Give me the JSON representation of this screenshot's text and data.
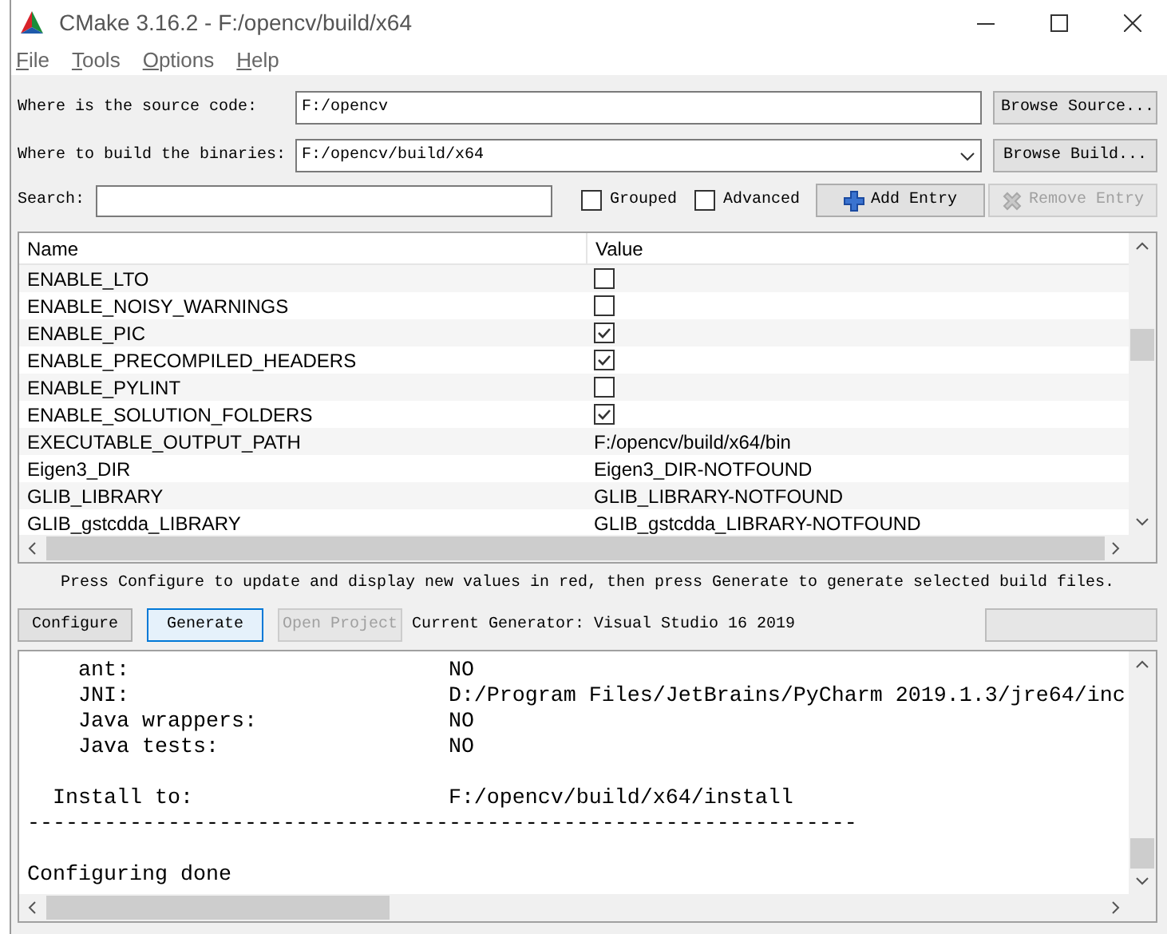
{
  "window": {
    "title": "CMake 3.16.2 - F:/opencv/build/x64"
  },
  "menu": [
    "File",
    "Tools",
    "Options",
    "Help"
  ],
  "source": {
    "label": "Where is the source code:",
    "value": "F:/opencv",
    "button": "Browse Source..."
  },
  "build": {
    "label": "Where to build the binaries:",
    "value": "F:/opencv/build/x64",
    "button": "Browse Build..."
  },
  "search": {
    "label": "Search:"
  },
  "options": [
    {
      "label": "Grouped",
      "checked": false
    },
    {
      "label": "Advanced",
      "checked": false
    }
  ],
  "entry_buttons": [
    {
      "label": "Add Entry",
      "kind": "add",
      "disabled": false
    },
    {
      "label": "Remove Entry",
      "kind": "remove",
      "disabled": true
    }
  ],
  "table": {
    "columns": [
      "Name",
      "Value"
    ],
    "rows": [
      {
        "name": "ENABLE_LTO",
        "kind": "bool",
        "checked": false
      },
      {
        "name": "ENABLE_NOISY_WARNINGS",
        "kind": "bool",
        "checked": false
      },
      {
        "name": "ENABLE_PIC",
        "kind": "bool",
        "checked": true
      },
      {
        "name": "ENABLE_PRECOMPILED_HEADERS",
        "kind": "bool",
        "checked": true
      },
      {
        "name": "ENABLE_PYLINT",
        "kind": "bool",
        "checked": false
      },
      {
        "name": "ENABLE_SOLUTION_FOLDERS",
        "kind": "bool",
        "checked": true
      },
      {
        "name": "EXECUTABLE_OUTPUT_PATH",
        "kind": "text",
        "value": "F:/opencv/build/x64/bin"
      },
      {
        "name": "Eigen3_DIR",
        "kind": "text",
        "value": "Eigen3_DIR-NOTFOUND"
      },
      {
        "name": "GLIB_LIBRARY",
        "kind": "text",
        "value": "GLIB_LIBRARY-NOTFOUND"
      },
      {
        "name": "GLIB_gstcdda_LIBRARY",
        "kind": "text",
        "value": "GLIB_gstcdda_LIBRARY-NOTFOUND"
      }
    ]
  },
  "message": "Press Configure to update and display new values in red, then press Generate to generate selected build files.",
  "actions": [
    {
      "label": "Configure",
      "default": false,
      "disabled": false
    },
    {
      "label": "Generate",
      "default": true,
      "disabled": false
    },
    {
      "label": "Open Project",
      "default": false,
      "disabled": true
    }
  ],
  "generator": "Current Generator: Visual Studio 16 2019",
  "progress": {
    "level": 0
  },
  "log_blocks": [
    [
      "    ant:                         NO",
      "    JNI:                         D:/Program Files/JetBrains/PyCharm 2019.1.3/jre64/inc",
      "    Java wrappers:               NO",
      "    Java tests:                  NO"
    ],
    [
      "  Install to:                    F:/opencv/build/x64/install",
      "-----------------------------------------------------------------"
    ],
    [
      "Configuring done"
    ]
  ]
}
